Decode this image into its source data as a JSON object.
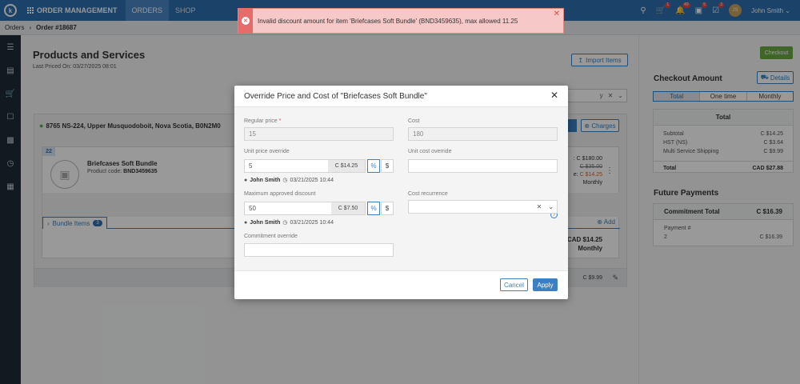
{
  "topbar": {
    "logo_letter": "k",
    "app_title": "ORDER MANAGEMENT",
    "nav": [
      "ORDERS",
      "SHOP"
    ],
    "icons": [
      {
        "name": "cart-icon",
        "badge": "1"
      },
      {
        "name": "bell-icon",
        "badge": "49"
      },
      {
        "name": "briefcase-icon",
        "badge": "5"
      },
      {
        "name": "task-icon",
        "badge": "3"
      }
    ],
    "avatar_initials": "JS",
    "user_name": "John Smith",
    "user_caret": "⌄"
  },
  "breadcrumb": {
    "root": "Orders",
    "separator": "›",
    "current": "Order #18687"
  },
  "sidebar": {
    "icons": [
      "menu-icon",
      "document-icon",
      "cart-icon",
      "clipboard-icon",
      "chat-icon",
      "clock-icon",
      "calendar-icon"
    ]
  },
  "page": {
    "title": "Products and Services",
    "last_priced": "Last Priced On: 03/27/2025 08:01",
    "import_btn": "Import Items",
    "select_suffix": "y",
    "location": "8765 NS-224, Upper Musquodoboit, Nova Scotia, B0N2M0",
    "charges_btn": "Charges",
    "item": {
      "qty": "22",
      "name": "Briefcases Soft Bundle",
      "code_label": "Product code:",
      "code": "BND3459635",
      "price_1": ": C $180.00",
      "price_2": "C $35.00",
      "price_3_prefix": "e:",
      "price_3": "C $14.25",
      "recurrence": "Monthly",
      "bundle_label": "Bundle Items",
      "bundle_count": "3",
      "add_label": "Add",
      "total_line": "CAD $14.25",
      "total_recurrence": "Monthly"
    },
    "footer_price": "C $9.99"
  },
  "right": {
    "checkout_btn": "Checkout",
    "checkout_title": "Checkout Amount",
    "details_btn": "Details",
    "tabs": [
      "Total",
      "One time",
      "Monthly"
    ],
    "total_head": "Total",
    "rows": [
      {
        "label": "Subtotal",
        "value": "C $14.25"
      },
      {
        "label": "HST (NS)",
        "value": "C $3.64"
      },
      {
        "label": "Multi Service Shipping",
        "value": "C $9.99"
      }
    ],
    "total_label": "Total",
    "total_value": "CAD $27.88",
    "future_title": "Future Payments",
    "commitment_label": "Commitment Total",
    "commitment_value": "C $16.39",
    "payment_label": "Payment #",
    "payment_num": "2",
    "payment_value": "C $16.39"
  },
  "modal": {
    "title": "Override Price and Cost of \"Briefcases Soft Bundle\"",
    "close": "✕",
    "regular_price_label": "Regular price",
    "required_mark": "*",
    "regular_price": "15",
    "cost_label": "Cost",
    "cost": "180",
    "unit_price_label": "Unit price override",
    "unit_price": "5",
    "unit_price_addon": "C $14.25",
    "pct": "%",
    "usd": "$",
    "unit_cost_label": "Unit cost override",
    "audit_user": "John Smith",
    "audit_date_1": "03/21/2025 10:44",
    "max_discount_label": "Maximum approved discount",
    "max_discount": "50",
    "max_discount_addon": "C $7.50",
    "audit_date_2": "03/21/2025 10:44",
    "cost_recurrence_label": "Cost recurrence",
    "commitment_label": "Commitment override",
    "cancel": "Cancel",
    "apply": "Apply"
  },
  "toast": {
    "message": "Invalid discount amount for item 'Briefcases Soft Bundle' (BND3459635), max allowed 11.25",
    "close": "✕"
  }
}
